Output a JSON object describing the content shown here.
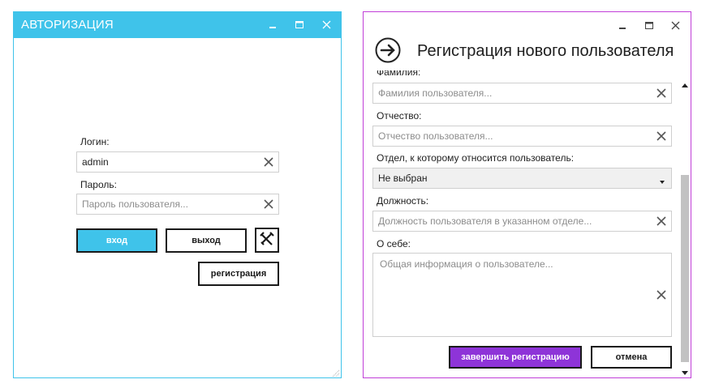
{
  "login_window": {
    "title": "АВТОРИЗАЦИЯ",
    "login_label": "Логин:",
    "login_value": "admin",
    "password_label": "Пароль:",
    "password_placeholder": "Пароль пользователя...",
    "login_button": "вход",
    "exit_button": "выход",
    "settings_icon": "tools-icon",
    "register_button": "регистрация"
  },
  "registration_window": {
    "title": "Регистрация нового пользователя",
    "back_icon": "arrow-right-circle-icon",
    "fields": {
      "surname_label": "Фамилия:",
      "surname_placeholder": "Фамилия пользователя...",
      "patronymic_label": "Отчество:",
      "patronymic_placeholder": "Отчество пользователя...",
      "department_label": "Отдел, к которому относится пользователь:",
      "department_value": "Не выбран",
      "position_label": "Должность:",
      "position_placeholder": "Должность пользователя в указанном отделе...",
      "about_label": "О себе:",
      "about_placeholder": "Общая информация о пользователе..."
    },
    "finish_button": "завершить регистрацию",
    "cancel_button": "отмена"
  },
  "colors": {
    "login_accent": "#3fc3ea",
    "registration_border": "#c13fd8",
    "finish_button": "#8e34d8"
  }
}
